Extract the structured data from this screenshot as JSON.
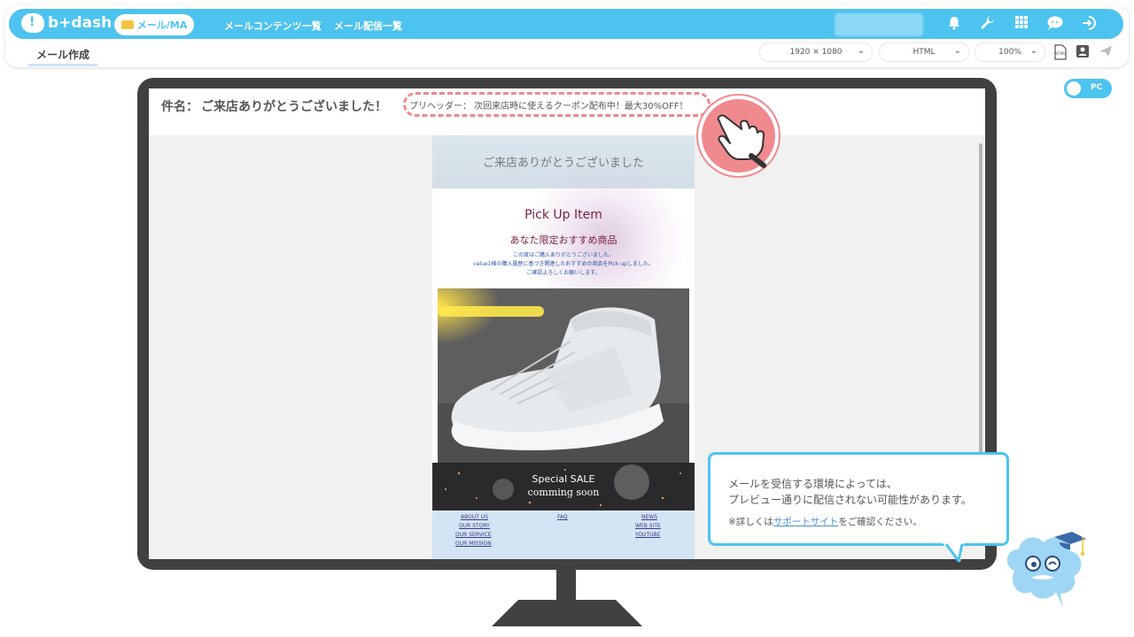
{
  "header": {
    "logo_text": "b+dash",
    "module_pill": "メール/MA",
    "nav_links": [
      "メールコンテンツ一覧",
      "メール配信一覧"
    ],
    "icons": [
      "bell-icon",
      "wrench-icon",
      "grid-icon",
      "chat-icon",
      "logout-icon"
    ]
  },
  "toolbar": {
    "tab_label": "メール作成",
    "resolution": "1920 × 1080",
    "format": "HTML",
    "zoom": "100%"
  },
  "toggle": {
    "label": "PC",
    "on": true
  },
  "preview": {
    "subject_label": "件名：",
    "subject_text": "ご来店ありがとうございました！",
    "preheader": "プリヘッダー： 次回来店時に使えるクーポン配布中！最大30%OFF！"
  },
  "email": {
    "hero_text": "ご来店ありがとうございました",
    "pickup_title": "Pick Up Item",
    "recommend_title": "あなた限定おすすめ商品",
    "body_lines": [
      "この度はご購入ありがとうございました。",
      "value1様の購入履歴に基づき関連したおすすめの商品をPick upしました。",
      "ご確認よろしくお願いします。"
    ],
    "sale_title": "Special SALE",
    "sale_sub": "comming soon",
    "footer": {
      "col1": [
        "ABOUT US",
        "OUR STORY",
        "OUR SERVICE",
        "OUR MISSION"
      ],
      "col2": [
        "FAQ"
      ],
      "col3": [
        "NEWS",
        "WEB SITE",
        "YOUTUBE"
      ]
    }
  },
  "bubble": {
    "line1": "メールを受信する環境によっては、",
    "line2": "プレビュー通りに配信されない可能性があります。",
    "note_prefix": "※詳しくは",
    "note_link": "サポートサイト",
    "note_suffix": "をご確認ください。"
  },
  "colors": {
    "brand": "#4dc3ef",
    "highlight": "#f08a8e",
    "monitor": "#404040"
  }
}
